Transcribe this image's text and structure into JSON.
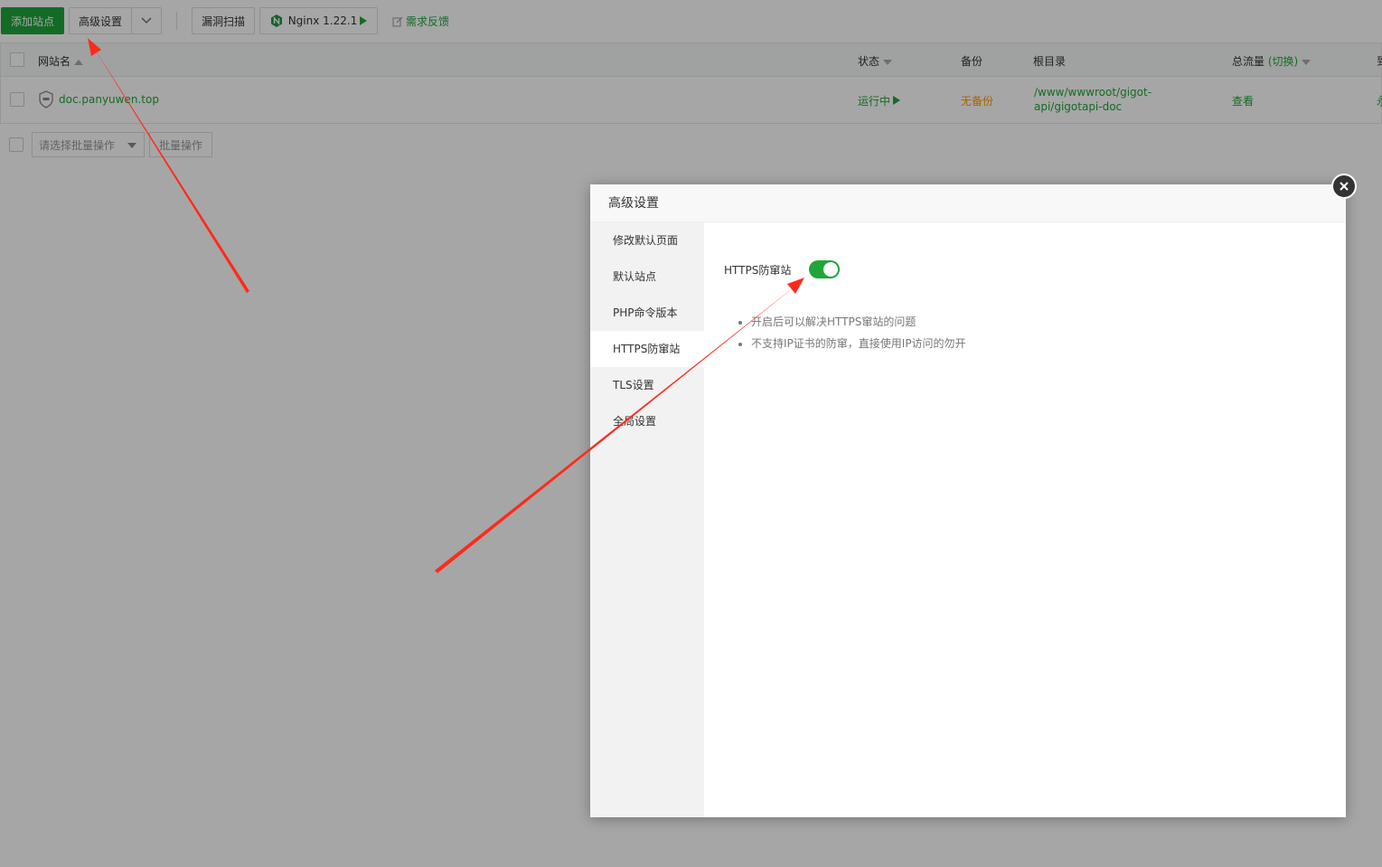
{
  "toolbar": {
    "add_site": "添加站点",
    "advanced_settings": "高级设置",
    "vuln_scan": "漏洞扫描",
    "nginx": "Nginx 1.22.1",
    "feedback": "需求反馈"
  },
  "table": {
    "headers": {
      "site_name": "网站名",
      "status": "状态",
      "backup": "备份",
      "root_dir": "根目录",
      "traffic": "总流量",
      "traffic_switch": "(切换)",
      "extra": "到"
    },
    "rows": [
      {
        "site": "doc.panyuwen.top",
        "status": "运行中",
        "backup": "无备份",
        "root_line1": "/www/wwwroot/gigot-",
        "root_line2": "api/gigotapi-doc",
        "traffic": "查看",
        "extra": "永"
      }
    ]
  },
  "batch": {
    "select_placeholder": "请选择批量操作",
    "button": "批量操作"
  },
  "modal": {
    "title": "高级设置",
    "sidebar": [
      {
        "label": "修改默认页面"
      },
      {
        "label": "默认站点"
      },
      {
        "label": "PHP命令版本"
      },
      {
        "label": "HTTPS防窜站"
      },
      {
        "label": "TLS设置"
      },
      {
        "label": "全局设置"
      }
    ],
    "active_item": "HTTPS防窜站",
    "field_label": "HTTPS防窜站",
    "toggle_on": true,
    "tips": [
      "开启后可以解决HTTPS窜站的问题",
      "不支持IP证书的防窜，直接使用IP访问的勿开"
    ]
  },
  "colors": {
    "brand_green": "#20a53a",
    "warning_orange": "#ff9900",
    "annotation_red": "#ff2a1a"
  }
}
